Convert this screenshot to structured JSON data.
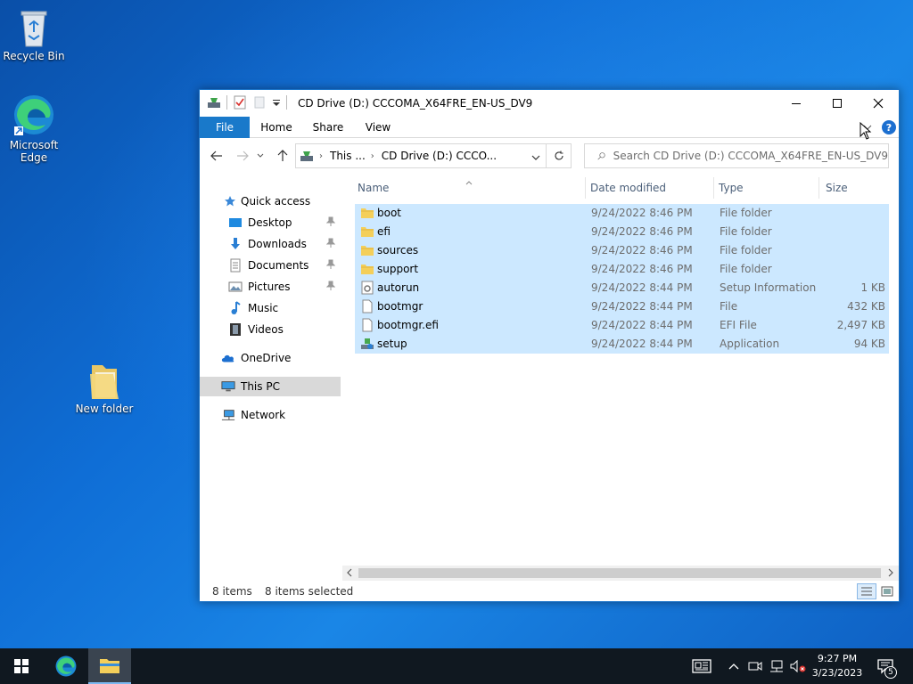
{
  "desktop": {
    "icons": [
      {
        "label": "Recycle Bin"
      },
      {
        "label": "Microsoft Edge"
      },
      {
        "label": "New folder"
      }
    ]
  },
  "window": {
    "title": "CD Drive (D:) CCCOMA_X64FRE_EN-US_DV9",
    "tabs": [
      "File",
      "Home",
      "Share",
      "View"
    ],
    "address": {
      "crumbs": [
        "This ...",
        "CD Drive (D:) CCCO..."
      ]
    },
    "search": {
      "placeholder": "Search CD Drive (D:) CCCOMA_X64FRE_EN-US_DV9"
    },
    "nav": {
      "quick_access": "Quick access",
      "items": [
        "Desktop",
        "Downloads",
        "Documents",
        "Pictures",
        "Music",
        "Videos"
      ],
      "onedrive": "OneDrive",
      "this_pc": "This PC",
      "network": "Network"
    },
    "columns": [
      "Name",
      "Date modified",
      "Type",
      "Size"
    ],
    "files": [
      {
        "name": "boot",
        "date": "9/24/2022 8:46 PM",
        "type": "File folder",
        "size": "",
        "icon": "folder-icon"
      },
      {
        "name": "efi",
        "date": "9/24/2022 8:46 PM",
        "type": "File folder",
        "size": "",
        "icon": "folder-icon"
      },
      {
        "name": "sources",
        "date": "9/24/2022 8:46 PM",
        "type": "File folder",
        "size": "",
        "icon": "folder-icon"
      },
      {
        "name": "support",
        "date": "9/24/2022 8:46 PM",
        "type": "File folder",
        "size": "",
        "icon": "folder-icon"
      },
      {
        "name": "autorun",
        "date": "9/24/2022 8:44 PM",
        "type": "Setup Information",
        "size": "1 KB",
        "icon": "settings-file-icon"
      },
      {
        "name": "bootmgr",
        "date": "9/24/2022 8:44 PM",
        "type": "File",
        "size": "432 KB",
        "icon": "file-icon"
      },
      {
        "name": "bootmgr.efi",
        "date": "9/24/2022 8:44 PM",
        "type": "EFI File",
        "size": "2,497 KB",
        "icon": "file-icon"
      },
      {
        "name": "setup",
        "date": "9/24/2022 8:44 PM",
        "type": "Application",
        "size": "94 KB",
        "icon": "setup-app-icon"
      }
    ],
    "status": {
      "count": "8 items",
      "selected": "8 items selected"
    }
  },
  "taskbar": {
    "time": "9:27 PM",
    "date": "3/23/2023",
    "notification_count": "5"
  },
  "colors": {
    "accent": "#1979ca",
    "selection": "#cce8ff",
    "taskbar": "#101820"
  }
}
